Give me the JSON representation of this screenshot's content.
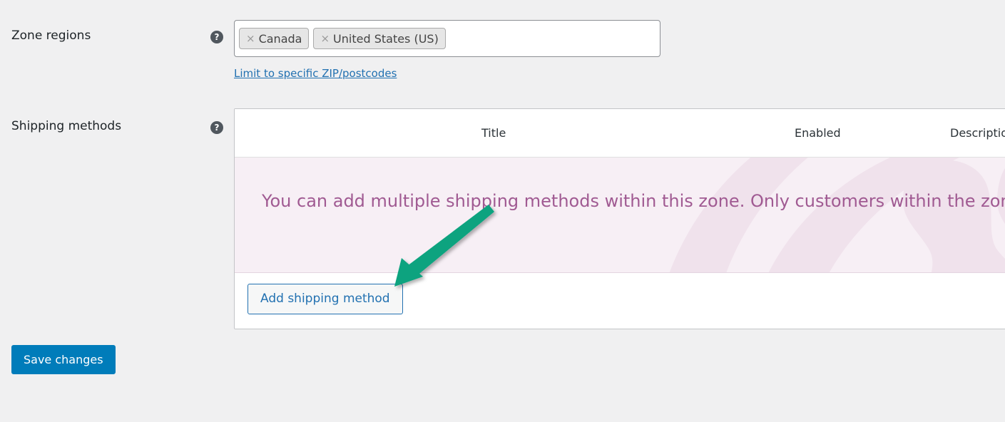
{
  "page": {
    "background_color": "#f0f0f1"
  },
  "zone_regions": {
    "label": "Zone regions",
    "help_icon": "question-mark-circle-icon",
    "selected_regions": [
      {
        "remove_glyph": "×",
        "name": "Canada"
      },
      {
        "remove_glyph": "×",
        "name": "United States (US)"
      }
    ],
    "zip_link": "Limit to specific ZIP/postcodes"
  },
  "shipping_methods": {
    "label": "Shipping methods",
    "help_icon": "question-mark-circle-icon",
    "table": {
      "columns": [
        "Title",
        "Enabled",
        "Descriptio"
      ],
      "notice": "You can add multiple shipping methods within this zone. Only customers within the zone will see them.",
      "notice_text_color": "#a05a92",
      "notice_background_color": "#f7eff5"
    },
    "add_method_button": "Add shipping method"
  },
  "footer": {
    "save_button": "Save changes",
    "save_button_color": "#007cba"
  },
  "annotation": {
    "arrow_color": "#0aa37f",
    "arrow_direction": "down-left",
    "points_to": "Add shipping method"
  }
}
